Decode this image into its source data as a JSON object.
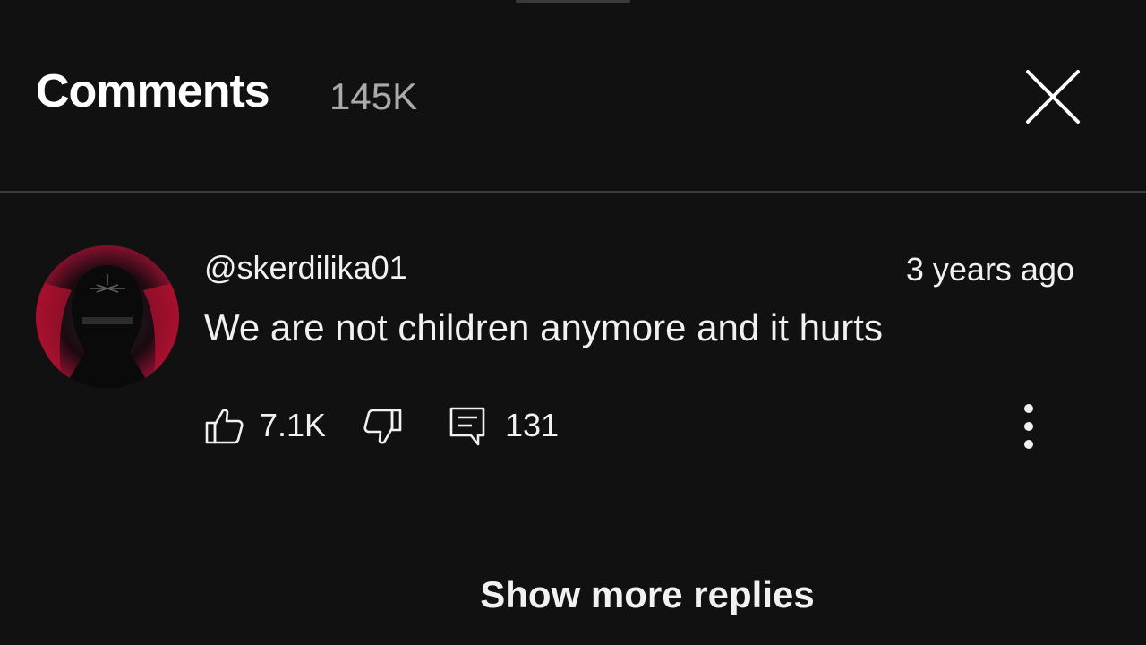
{
  "header": {
    "title": "Comments",
    "count": "145K"
  },
  "comment": {
    "author": "@skerdilika01",
    "timestamp": "3 years ago",
    "text": "We are not children anymore and it hurts",
    "likes": "7.1K",
    "replies": "131",
    "avatar_colors": {
      "outer": "#c0143c",
      "inner": "#0d0d0d"
    }
  },
  "footer": {
    "show_more_label": "Show more replies"
  },
  "icons": {
    "close": "close-icon",
    "like": "thumbs-up-icon",
    "dislike": "thumbs-down-icon",
    "reply": "reply-icon",
    "more": "more-vert-icon"
  }
}
